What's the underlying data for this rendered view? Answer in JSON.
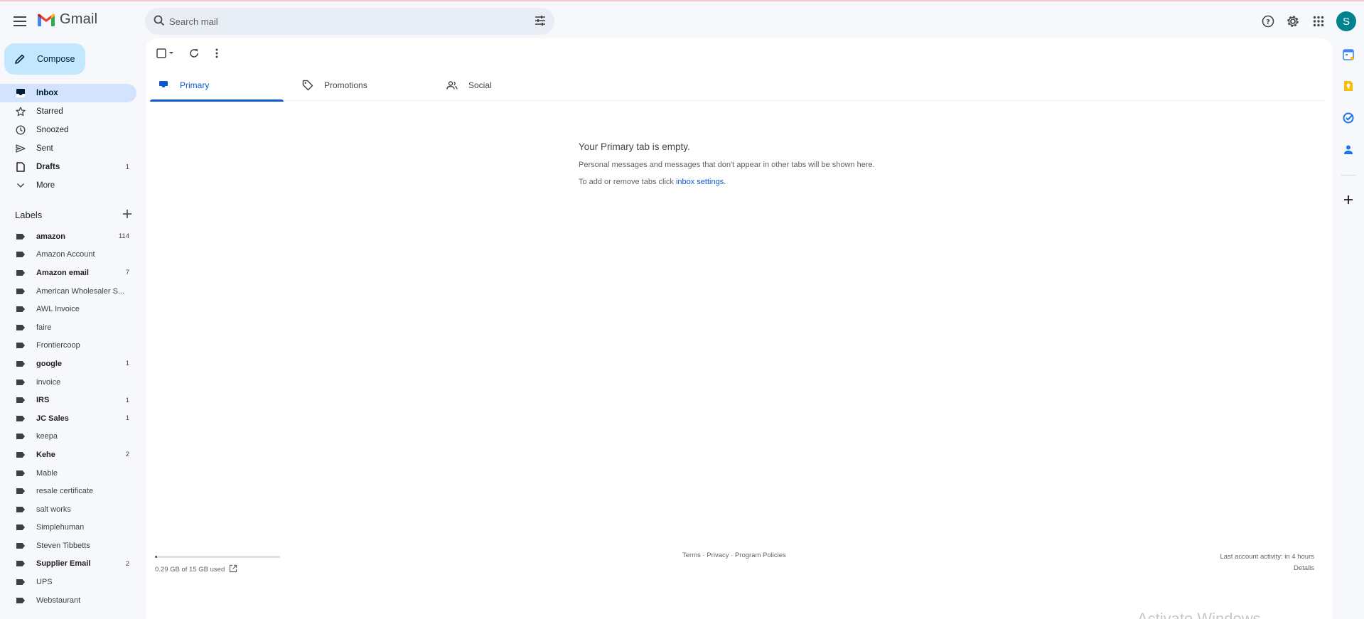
{
  "header": {
    "app_name": "Gmail",
    "search_placeholder": "Search mail",
    "avatar_letter": "S",
    "icons": [
      "menu-icon",
      "gmail-logo",
      "search-icon",
      "tune-icon",
      "help-icon",
      "gear-icon",
      "apps-icon"
    ]
  },
  "sidebar": {
    "compose_label": "Compose",
    "nav": [
      {
        "label": "Inbox",
        "icon": "inbox-icon",
        "count": "",
        "active": true
      },
      {
        "label": "Starred",
        "icon": "star-icon",
        "count": ""
      },
      {
        "label": "Snoozed",
        "icon": "clock-icon",
        "count": ""
      },
      {
        "label": "Sent",
        "icon": "send-icon",
        "count": ""
      },
      {
        "label": "Drafts",
        "icon": "draft-icon",
        "count": "1",
        "bold": true
      },
      {
        "label": "More",
        "icon": "chevron-down-icon",
        "count": ""
      }
    ],
    "labels_title": "Labels",
    "labels": [
      {
        "label": "amazon",
        "count": "114",
        "bold": true
      },
      {
        "label": "Amazon Account",
        "count": ""
      },
      {
        "label": "Amazon email",
        "count": "7",
        "bold": true
      },
      {
        "label": "American Wholesaler S...",
        "count": ""
      },
      {
        "label": "AWL Invoice",
        "count": ""
      },
      {
        "label": "faire",
        "count": ""
      },
      {
        "label": "Frontiercoop",
        "count": ""
      },
      {
        "label": "google",
        "count": "1",
        "bold": true
      },
      {
        "label": "invoice",
        "count": ""
      },
      {
        "label": "IRS",
        "count": "1",
        "bold": true
      },
      {
        "label": "JC Sales",
        "count": "1",
        "bold": true
      },
      {
        "label": "keepa",
        "count": ""
      },
      {
        "label": "Kehe",
        "count": "2",
        "bold": true
      },
      {
        "label": "Mable",
        "count": ""
      },
      {
        "label": "resale certificate",
        "count": ""
      },
      {
        "label": "salt works",
        "count": ""
      },
      {
        "label": "Simplehuman",
        "count": ""
      },
      {
        "label": "Steven Tibbetts",
        "count": ""
      },
      {
        "label": "Supplier Email",
        "count": "2",
        "bold": true
      },
      {
        "label": "UPS",
        "count": ""
      },
      {
        "label": "Webstaurant",
        "count": ""
      }
    ]
  },
  "main": {
    "tabs": [
      {
        "label": "Primary",
        "icon": "inbox-icon",
        "active": true
      },
      {
        "label": "Promotions",
        "icon": "tag-icon"
      },
      {
        "label": "Social",
        "icon": "people-icon"
      }
    ],
    "empty": {
      "title": "Your Primary tab is empty.",
      "line1": "Personal messages and messages that don't appear in other tabs will be shown here.",
      "line2_prefix": "To add or remove tabs click ",
      "line2_link": "inbox settings",
      "line2_suffix": "."
    },
    "footer": {
      "storage_used_fraction": 0.019,
      "storage_text": "0.29 GB of 15 GB used",
      "link_terms": "Terms",
      "link_privacy": "Privacy",
      "link_policies": "Program Policies",
      "separator": " · ",
      "activity": "Last account activity: in 4 hours",
      "details": "Details"
    }
  },
  "watermark": "Activate Windows",
  "colors": {
    "accent": "#0b57d0",
    "compose_bg": "#c2e7ff",
    "active_nav_bg": "#d3e3fd",
    "avatar_bg": "#00838f"
  }
}
